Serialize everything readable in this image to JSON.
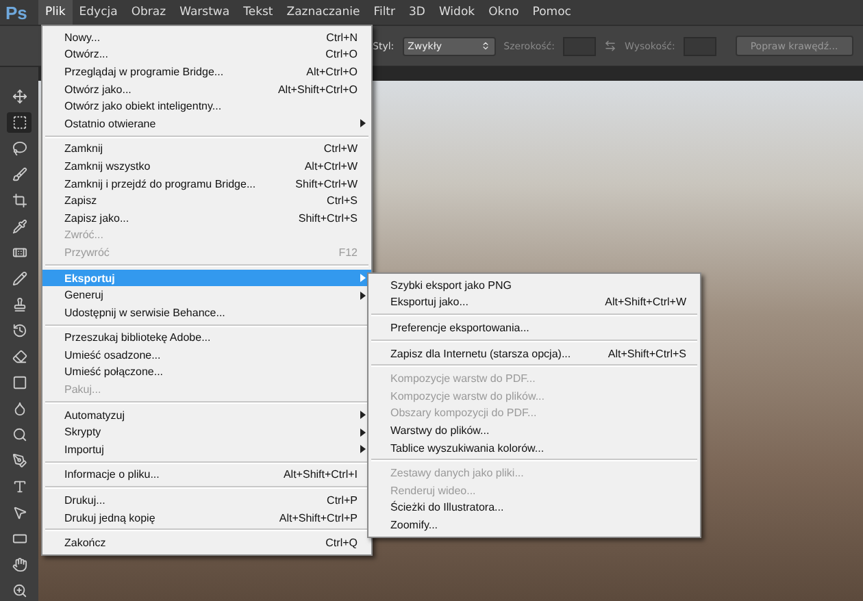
{
  "app_logo": "Ps",
  "menubar": [
    {
      "label": "Plik",
      "selected": true
    },
    {
      "label": "Edycja",
      "selected": false
    },
    {
      "label": "Obraz",
      "selected": false
    },
    {
      "label": "Warstwa",
      "selected": false
    },
    {
      "label": "Tekst",
      "selected": false
    },
    {
      "label": "Zaznaczanie",
      "selected": false
    },
    {
      "label": "Filtr",
      "selected": false
    },
    {
      "label": "3D",
      "selected": false
    },
    {
      "label": "Widok",
      "selected": false
    },
    {
      "label": "Okno",
      "selected": false
    },
    {
      "label": "Pomoc",
      "selected": false
    }
  ],
  "options_bar": {
    "style_label": "Styl:",
    "style_value": "Zwykły",
    "width_label": "Szerokość:",
    "height_label": "Wysokość:",
    "refine_button": "Popraw krawędź..."
  },
  "tools": [
    {
      "kind": "move",
      "selected": false
    },
    {
      "kind": "marquee",
      "selected": true
    },
    {
      "kind": "lasso",
      "selected": false
    },
    {
      "kind": "brush",
      "selected": false
    },
    {
      "kind": "crop",
      "selected": false
    },
    {
      "kind": "eyedropper",
      "selected": false
    },
    {
      "kind": "bandage",
      "selected": false
    },
    {
      "kind": "pencil",
      "selected": false
    },
    {
      "kind": "stamp",
      "selected": false
    },
    {
      "kind": "history",
      "selected": false
    },
    {
      "kind": "eraser",
      "selected": false
    },
    {
      "kind": "gradient",
      "selected": false
    },
    {
      "kind": "drop",
      "selected": false
    },
    {
      "kind": "dodge",
      "selected": false
    },
    {
      "kind": "pen",
      "selected": false
    },
    {
      "kind": "type",
      "selected": false
    },
    {
      "kind": "pointer",
      "selected": false
    },
    {
      "kind": "rectangle",
      "selected": false
    },
    {
      "kind": "hand",
      "selected": false
    },
    {
      "kind": "zoom",
      "selected": false
    }
  ],
  "file_menu": [
    [
      {
        "label": "Nowy...",
        "shortcut": "Ctrl+N",
        "disabled": false,
        "submenu": false,
        "selected": false
      },
      {
        "label": "Otwórz...",
        "shortcut": "Ctrl+O",
        "disabled": false,
        "submenu": false,
        "selected": false
      },
      {
        "label": "Przeglądaj w programie Bridge...",
        "shortcut": "Alt+Ctrl+O",
        "disabled": false,
        "submenu": false,
        "selected": false
      },
      {
        "label": "Otwórz jako...",
        "shortcut": "Alt+Shift+Ctrl+O",
        "disabled": false,
        "submenu": false,
        "selected": false
      },
      {
        "label": "Otwórz jako obiekt inteligentny...",
        "disabled": false,
        "submenu": false,
        "selected": false
      },
      {
        "label": "Ostatnio otwierane",
        "disabled": false,
        "submenu": true,
        "selected": false
      }
    ],
    [
      {
        "label": "Zamknij",
        "shortcut": "Ctrl+W",
        "disabled": false,
        "submenu": false,
        "selected": false
      },
      {
        "label": "Zamknij wszystko",
        "shortcut": "Alt+Ctrl+W",
        "disabled": false,
        "submenu": false,
        "selected": false
      },
      {
        "label": "Zamknij i przejdź do programu Bridge...",
        "shortcut": "Shift+Ctrl+W",
        "disabled": false,
        "submenu": false,
        "selected": false
      },
      {
        "label": "Zapisz",
        "shortcut": "Ctrl+S",
        "disabled": false,
        "submenu": false,
        "selected": false
      },
      {
        "label": "Zapisz jako...",
        "shortcut": "Shift+Ctrl+S",
        "disabled": false,
        "submenu": false,
        "selected": false
      },
      {
        "label": "Zwróć...",
        "disabled": true,
        "submenu": false,
        "selected": false
      },
      {
        "label": "Przywróć",
        "shortcut": "F12",
        "disabled": true,
        "submenu": false,
        "selected": false
      }
    ],
    [
      {
        "label": "Eksportuj",
        "disabled": false,
        "submenu": true,
        "selected": true
      },
      {
        "label": "Generuj",
        "disabled": false,
        "submenu": true,
        "selected": false
      },
      {
        "label": "Udostępnij w serwisie Behance...",
        "disabled": false,
        "submenu": false,
        "selected": false
      }
    ],
    [
      {
        "label": "Przeszukaj bibliotekę Adobe...",
        "disabled": false,
        "submenu": false,
        "selected": false
      },
      {
        "label": "Umieść osadzone...",
        "disabled": false,
        "submenu": false,
        "selected": false
      },
      {
        "label": "Umieść połączone...",
        "disabled": false,
        "submenu": false,
        "selected": false
      },
      {
        "label": "Pakuj...",
        "disabled": true,
        "submenu": false,
        "selected": false
      }
    ],
    [
      {
        "label": "Automatyzuj",
        "disabled": false,
        "submenu": true,
        "selected": false
      },
      {
        "label": "Skrypty",
        "disabled": false,
        "submenu": true,
        "selected": false
      },
      {
        "label": "Importuj",
        "disabled": false,
        "submenu": true,
        "selected": false
      }
    ],
    [
      {
        "label": "Informacje o pliku...",
        "shortcut": "Alt+Shift+Ctrl+I",
        "disabled": false,
        "submenu": false,
        "selected": false
      }
    ],
    [
      {
        "label": "Drukuj...",
        "shortcut": "Ctrl+P",
        "disabled": false,
        "submenu": false,
        "selected": false
      },
      {
        "label": "Drukuj jedną kopię",
        "shortcut": "Alt+Shift+Ctrl+P",
        "disabled": false,
        "submenu": false,
        "selected": false
      }
    ],
    [
      {
        "label": "Zakończ",
        "shortcut": "Ctrl+Q",
        "disabled": false,
        "submenu": false,
        "selected": false
      }
    ]
  ],
  "export_submenu": [
    [
      {
        "label": "Szybki eksport jako PNG",
        "disabled": false
      },
      {
        "label": "Eksportuj jako...",
        "shortcut": "Alt+Shift+Ctrl+W",
        "disabled": false
      }
    ],
    [
      {
        "label": "Preferencje eksportowania...",
        "disabled": false
      }
    ],
    [
      {
        "label": "Zapisz dla Internetu (starsza opcja)...",
        "shortcut": "Alt+Shift+Ctrl+S",
        "disabled": false
      }
    ],
    [
      {
        "label": "Kompozycje warstw do PDF...",
        "disabled": true
      },
      {
        "label": "Kompozycje warstw do plików...",
        "disabled": true
      },
      {
        "label": "Obszary kompozycji do PDF...",
        "disabled": true
      },
      {
        "label": "Warstwy do plików...",
        "disabled": false
      },
      {
        "label": "Tablice wyszukiwania kolorów...",
        "disabled": false
      }
    ],
    [
      {
        "label": "Zestawy danych jako pliki...",
        "disabled": true
      },
      {
        "label": "Renderuj wideo...",
        "disabled": true
      },
      {
        "label": "Ścieżki do Illustratora...",
        "disabled": false
      },
      {
        "label": "Zoomify...",
        "disabled": false
      }
    ]
  ]
}
